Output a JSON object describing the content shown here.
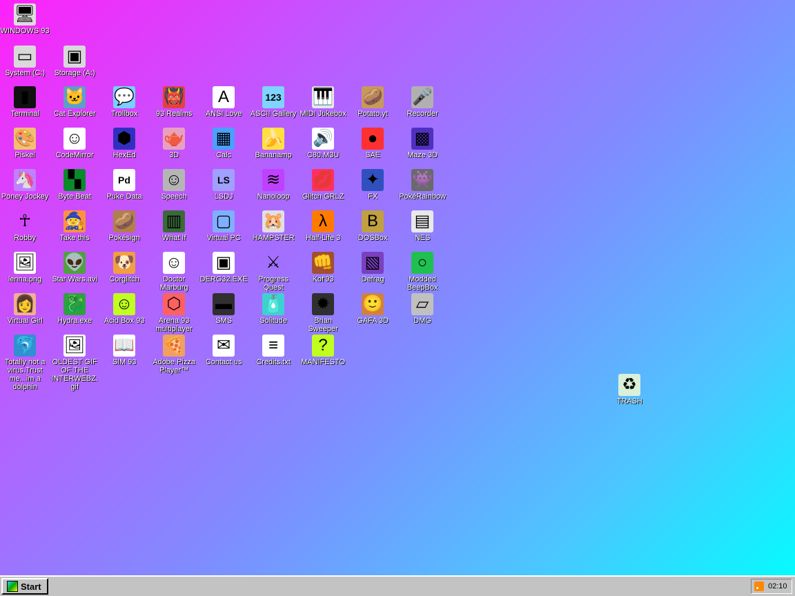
{
  "icons": [
    {
      "id": "windows-93",
      "label": "WINDOWS 93",
      "glyph": "🖥",
      "bg": "#dddddd",
      "col": 0,
      "row": -1
    },
    {
      "id": "system-c",
      "label": "System (C:)",
      "glyph": "▭",
      "bg": "#d9d9d9",
      "col": 0,
      "row": -0.5
    },
    {
      "id": "storage-a",
      "label": "Storage (A:)",
      "glyph": "▣",
      "bg": "#d9d9d9",
      "col": 1,
      "row": -0.5
    },
    {
      "id": "terminal",
      "label": "Terminal",
      "glyph": "▮",
      "bg": "#111111",
      "col": 0,
      "row": 0
    },
    {
      "id": "cat-explorer",
      "label": "Cat Explorer",
      "glyph": "🐱",
      "bg": "#5aa0c8",
      "col": 1,
      "row": 0
    },
    {
      "id": "trollbox",
      "label": "Trollbox",
      "glyph": "💬",
      "bg": "#79d0ff",
      "col": 2,
      "row": 0
    },
    {
      "id": "93-realms",
      "label": "93 Realms",
      "glyph": "👹",
      "bg": "#e44040",
      "col": 3,
      "row": 0
    },
    {
      "id": "ansi-love",
      "label": "ANSI Love",
      "glyph": "A",
      "bg": "#ffffff",
      "col": 4,
      "row": 0
    },
    {
      "id": "ascii-gallery",
      "label": "ASCII Gallery",
      "glyph": "123",
      "bg": "#7fd4ff",
      "col": 5,
      "row": 0
    },
    {
      "id": "midi-jukebox",
      "label": "MIDI Jukebox",
      "glyph": "🎹",
      "bg": "#e6e6e6",
      "col": 6,
      "row": 0
    },
    {
      "id": "potato-yt",
      "label": "Potato.yt",
      "glyph": "🥔",
      "bg": "#c89a5a",
      "col": 7,
      "row": 0
    },
    {
      "id": "recorder",
      "label": "Recorder",
      "glyph": "🎤",
      "bg": "#b0b0b0",
      "col": 8,
      "row": 0
    },
    {
      "id": "piskel",
      "label": "Piskel",
      "glyph": "🎨",
      "bg": "#f0c070",
      "col": 0,
      "row": 1
    },
    {
      "id": "codemirror",
      "label": "CodeMirror",
      "glyph": "☺",
      "bg": "#ffffff",
      "col": 1,
      "row": 1
    },
    {
      "id": "hexed",
      "label": "HexEd",
      "glyph": "⬢",
      "bg": "#3030c0",
      "col": 2,
      "row": 1
    },
    {
      "id": "3d",
      "label": "3D",
      "glyph": "🫖",
      "bg": "#e9a0c0",
      "col": 3,
      "row": 1
    },
    {
      "id": "calc",
      "label": "Calc",
      "glyph": "▦",
      "bg": "#4aa0ff",
      "col": 4,
      "row": 1
    },
    {
      "id": "bananamp",
      "label": "Bananamp",
      "glyph": "🍌",
      "bg": "#ffe040",
      "col": 5,
      "row": 1
    },
    {
      "id": "c80-m3u",
      "label": "C80.M3U",
      "glyph": "🔊",
      "bg": "#ffffff",
      "col": 6,
      "row": 1
    },
    {
      "id": "sae",
      "label": "SAE",
      "glyph": "●",
      "bg": "#ff3030",
      "col": 7,
      "row": 1
    },
    {
      "id": "maze-3d",
      "label": "Maze 3D",
      "glyph": "▩",
      "bg": "#5030c0",
      "col": 8,
      "row": 1
    },
    {
      "id": "poney-jockey",
      "label": "Poney Jockey",
      "glyph": "🦄",
      "bg": "#c080ff",
      "col": 0,
      "row": 2
    },
    {
      "id": "byte-beat",
      "label": "Byte Beat",
      "glyph": "▚",
      "bg": "#0a8a2a",
      "col": 1,
      "row": 2
    },
    {
      "id": "puke-data",
      "label": "Puke Data",
      "glyph": "Pd",
      "bg": "#ffffff",
      "col": 2,
      "row": 2
    },
    {
      "id": "speech",
      "label": "Speech",
      "glyph": "☺",
      "bg": "#b5b5b5",
      "col": 3,
      "row": 2
    },
    {
      "id": "lsdj",
      "label": "LSDJ",
      "glyph": "LS",
      "bg": "#9fa0ff",
      "col": 4,
      "row": 2
    },
    {
      "id": "nanoloop",
      "label": "Nanoloop",
      "glyph": "≋",
      "bg": "#c040ff",
      "col": 5,
      "row": 2
    },
    {
      "id": "glitch-grlz",
      "label": "Glitch GRLZ",
      "glyph": "💋",
      "bg": "#ff3060",
      "col": 6,
      "row": 2
    },
    {
      "id": "fx",
      "label": "FX",
      "glyph": "✦",
      "bg": "#3050c0",
      "col": 7,
      "row": 2
    },
    {
      "id": "pokerainbow",
      "label": "PokéRainbow",
      "glyph": "👾",
      "bg": "#6a6a6a",
      "col": 8,
      "row": 2
    },
    {
      "id": "robby",
      "label": "Robby",
      "glyph": "☥",
      "bg": "transparent",
      "col": 0,
      "row": 3
    },
    {
      "id": "take-this",
      "label": "Take this",
      "glyph": "🧙",
      "bg": "#ff9040",
      "col": 1,
      "row": 3
    },
    {
      "id": "pokesign",
      "label": "Pokésign",
      "glyph": "🥔",
      "bg": "#b0804a",
      "col": 2,
      "row": 3
    },
    {
      "id": "what-if",
      "label": "What If",
      "glyph": "▥",
      "bg": "#3a6a3a",
      "col": 3,
      "row": 3
    },
    {
      "id": "virtual-pc",
      "label": "Virtual PC",
      "glyph": "▢",
      "bg": "#7fb0ff",
      "col": 4,
      "row": 3
    },
    {
      "id": "hampster",
      "label": "HAMPSTER",
      "glyph": "🐹",
      "bg": "#e0e0e0",
      "col": 5,
      "row": 3
    },
    {
      "id": "half-life-3",
      "label": "Half-Life 3",
      "glyph": "λ",
      "bg": "#ff7a00",
      "col": 6,
      "row": 3
    },
    {
      "id": "dosbox",
      "label": "DOSBox",
      "glyph": "B",
      "bg": "#c0a040",
      "col": 7,
      "row": 3
    },
    {
      "id": "nes",
      "label": "NES",
      "glyph": "▤",
      "bg": "#e8e8e8",
      "col": 8,
      "row": 3
    },
    {
      "id": "lenna-png",
      "label": "lenna.png",
      "glyph": "🖼",
      "bg": "#ffffff",
      "col": 0,
      "row": 4
    },
    {
      "id": "star-wars-avi",
      "label": "Star Wars.avi",
      "glyph": "👽",
      "bg": "#50a040",
      "col": 1,
      "row": 4
    },
    {
      "id": "corglitch",
      "label": "Corglitch",
      "glyph": "🐶",
      "bg": "#f0a040",
      "col": 2,
      "row": 4
    },
    {
      "id": "doctor-marburg",
      "label": "Doctor Marburg",
      "glyph": "☺",
      "bg": "#ffffff",
      "col": 3,
      "row": 4
    },
    {
      "id": "derg32-exe",
      "label": "DERG32.EXE",
      "glyph": "▣",
      "bg": "#ffffff",
      "col": 4,
      "row": 4
    },
    {
      "id": "progress-quest",
      "label": "Progress Quest",
      "glyph": "⚔",
      "bg": "transparent",
      "col": 5,
      "row": 4
    },
    {
      "id": "kof93",
      "label": "Kof'93",
      "glyph": "👊",
      "bg": "#a05030",
      "col": 6,
      "row": 4
    },
    {
      "id": "defrag",
      "label": "Defrag",
      "glyph": "▧",
      "bg": "#7a40c0",
      "col": 7,
      "row": 4
    },
    {
      "id": "modded-beepbox",
      "label": "Modded BeepBox",
      "glyph": "○",
      "bg": "#20c050",
      "col": 8,
      "row": 4
    },
    {
      "id": "virtual-girl",
      "label": "Virtual Girl",
      "glyph": "👩",
      "bg": "#f0b090",
      "col": 0,
      "row": 5
    },
    {
      "id": "hydra-exe",
      "label": "Hydra.exe",
      "glyph": "🐉",
      "bg": "#30a040",
      "col": 1,
      "row": 5
    },
    {
      "id": "acid-box-93",
      "label": "Acid Box 93",
      "glyph": "☺",
      "bg": "#c0ff20",
      "col": 2,
      "row": 5
    },
    {
      "id": "arena-93-multiplayer",
      "label": "Arena 93 multiplayer",
      "glyph": "⬡",
      "bg": "#ff6060",
      "col": 3,
      "row": 5
    },
    {
      "id": "sms",
      "label": "SMS",
      "glyph": "▬",
      "bg": "#303030",
      "col": 4,
      "row": 5
    },
    {
      "id": "solitude",
      "label": "Solitude",
      "glyph": "🧴",
      "bg": "#40d0d0",
      "col": 5,
      "row": 5
    },
    {
      "id": "brian-sweeper",
      "label": "Brian Sweeper",
      "glyph": "✹",
      "bg": "#303030",
      "col": 6,
      "row": 5
    },
    {
      "id": "gafa-3d",
      "label": "GAFA 3D",
      "glyph": "🙂",
      "bg": "#d08040",
      "col": 7,
      "row": 5
    },
    {
      "id": "dmg",
      "label": "DMG",
      "glyph": "▱",
      "bg": "#c0c0c0",
      "col": 8,
      "row": 5
    },
    {
      "id": "totally-not-a-virus",
      "label": "Totally not a virus.Trust me...im a dolphin",
      "glyph": "🐬",
      "bg": "#3090d0",
      "col": 0,
      "row": 6
    },
    {
      "id": "oldest-gif",
      "label": "OLDEST GIF OF THE INTERWEBZ.gif",
      "glyph": "🖼",
      "bg": "#ffffff",
      "col": 1,
      "row": 6
    },
    {
      "id": "sim-93",
      "label": "SIM 93",
      "glyph": "📖",
      "bg": "#ffffff",
      "col": 2,
      "row": 6
    },
    {
      "id": "adobe-pizza-player",
      "label": "Adobe Pizza Player™",
      "glyph": "🍕",
      "bg": "#f0a060",
      "col": 3,
      "row": 6
    },
    {
      "id": "contact-us",
      "label": "Contact us",
      "glyph": "✉",
      "bg": "#ffffff",
      "col": 4,
      "row": 6
    },
    {
      "id": "credits-txt",
      "label": "Credits.txt",
      "glyph": "≡",
      "bg": "#ffffff",
      "col": 5,
      "row": 6
    },
    {
      "id": "manifesto",
      "label": "MANIFESTO",
      "glyph": "?",
      "bg": "#c0ff20",
      "col": 6,
      "row": 6
    }
  ],
  "trash": {
    "label": "TRASH",
    "glyph": "♻"
  },
  "taskbar": {
    "start_label": "Start",
    "clock": "02:10"
  }
}
